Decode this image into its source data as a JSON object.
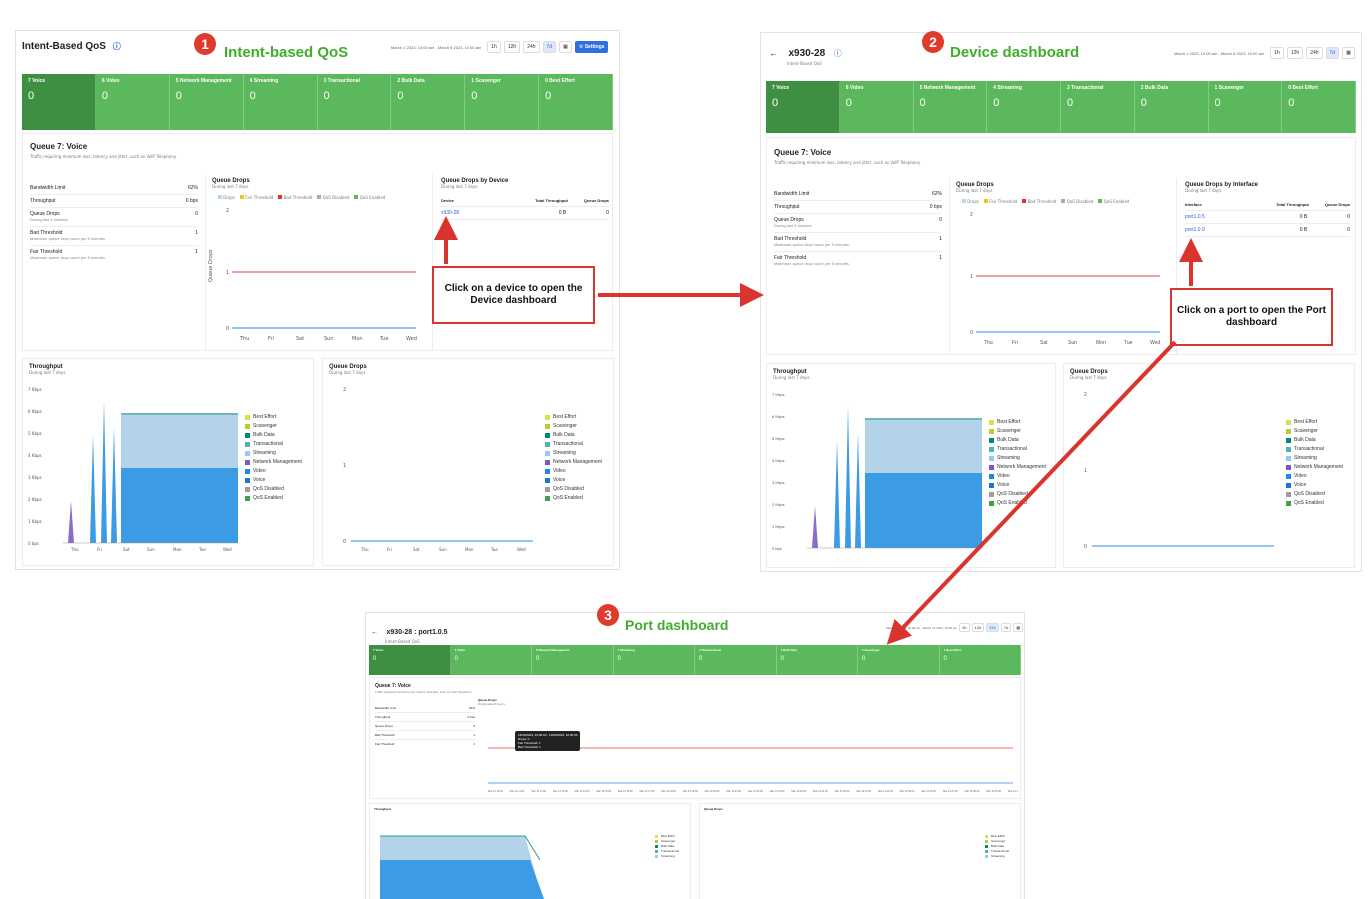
{
  "panel1": {
    "title": "Intent-Based QoS",
    "heading": "Intent-based QoS",
    "badge": "1",
    "date_range": "March 1 2023, 10:00 am - March 8 2023, 10:00 am",
    "time_buttons": [
      "1h",
      "12h",
      "24h",
      "7d"
    ],
    "active_time": "7d",
    "settings_label": "Settings",
    "queues": [
      {
        "label": "7 Voice",
        "value": "0"
      },
      {
        "label": "6 Video",
        "value": "0"
      },
      {
        "label": "5 Network Management",
        "value": "0"
      },
      {
        "label": "4 Streaming",
        "value": "0"
      },
      {
        "label": "3 Transactional",
        "value": "0"
      },
      {
        "label": "2 Bulk Data",
        "value": "0"
      },
      {
        "label": "1 Scavenger",
        "value": "0"
      },
      {
        "label": "0 Best Effort",
        "value": "0"
      }
    ],
    "queue_title": "Queue 7: Voice",
    "queue_desc": "Traffic requiring minimum loss, latency and jitter, such as VoIP Telephony",
    "stats": [
      {
        "label": "Bandwidth Limit",
        "sub": "",
        "value": "62%"
      },
      {
        "label": "Throughput",
        "sub": "",
        "value": "0 bps"
      },
      {
        "label": "Queue Drops",
        "sub": "During last 5 minutes",
        "value": "0"
      },
      {
        "label": "Bad Threshold",
        "sub": "Maximum queue drop count per 5 minutes",
        "value": "1"
      },
      {
        "label": "Fair Threshold",
        "sub": "Maximum queue drop count per 5 minutes",
        "value": "1"
      }
    ],
    "drops_title": "Queue Drops",
    "drops_sub": "During last 7 days",
    "drops_legend": [
      "Drops",
      "Fair Threshold",
      "Bad Threshold",
      "QoS Disabled",
      "QoS Enabled"
    ],
    "drops_yaxis": "Queue Drops",
    "days": [
      "Thu",
      "Fri",
      "Sat",
      "Sun",
      "Mon",
      "Tue",
      "Wed"
    ],
    "by_device_title": "Queue Drops by Device",
    "by_device_sub": "During last 7 days",
    "by_device_cols": [
      "Device",
      "Total Throughput",
      "Queue Drops"
    ],
    "by_device_row": {
      "device": "x930-28",
      "throughput": "0 B",
      "drops": "0"
    },
    "throughput_title": "Throughput",
    "throughput_sub": "During last 7 days",
    "throughput_yaxis": "Throughput",
    "throughput_ticks": [
      "7 Kbps",
      "6 Kbps",
      "5 Kbps",
      "4 Kbps",
      "3 Kbps",
      "2 Kbps",
      "1 Kbps",
      "0 bps"
    ],
    "qdrops2_title": "Queue Drops",
    "qdrops2_sub": "During last 7 days",
    "qdrops2_yaxis": "Queue Drops",
    "legend": [
      "Best Effort",
      "Scavenger",
      "Bulk Data",
      "Transactional",
      "Streaming",
      "Network Management",
      "Video",
      "Voice",
      "QoS Disabled",
      "QoS Enabled"
    ]
  },
  "panel2": {
    "title": "x930-28",
    "subtitle": "Intent-Based QoS",
    "heading": "Device dashboard",
    "badge": "2",
    "date_range": "March 1 2023, 10:00 am - March 8 2023, 10:00 am",
    "time_buttons": [
      "1h",
      "12h",
      "24h",
      "7d"
    ],
    "by_interface_title": "Queue Drops by Interface",
    "by_interface_sub": "During last 7 days",
    "by_interface_cols": [
      "Interface",
      "Total Throughput",
      "Queue Drops"
    ],
    "interfaces": [
      {
        "name": "port1.0.5",
        "throughput": "0 B",
        "drops": "0"
      },
      {
        "name": "port1.0.9",
        "throughput": "0 B",
        "drops": "0"
      }
    ]
  },
  "panel3": {
    "title": "x930-28 : port1.0.5",
    "subtitle": "Intent-Based QoS",
    "heading": "Port dashboard",
    "badge": "3",
    "date_range": "March 13 2023, 10:00 am - March 14 2023, 10:00 am",
    "time_buttons": [
      "1h",
      "12h",
      "24h",
      "7d"
    ],
    "drops_sub": "During last 24 hours",
    "tooltip": {
      "range": "13/03/2023, 10:00:00 - 13/03/2023, 10:30:00",
      "lines": [
        "Drops: 0",
        "Fair Threshold: 1",
        "Bad Threshold: 1"
      ]
    },
    "times": [
      "Mar 13 10:00",
      "Mar 13 11:00",
      "Mar 13 12:00",
      "Mar 13 13:00",
      "Mar 13 14:00",
      "Mar 13 15:00",
      "Mar 13 16:00",
      "Mar 13 17:00",
      "Mar 13 18:00",
      "Mar 13 19:00",
      "Mar 13 20:00",
      "Mar 13 21:00",
      "Mar 13 22:00",
      "Mar 13 23:00",
      "Mar 14 00:00",
      "Mar 14 01:00",
      "Mar 14 02:00",
      "Mar 14 03:00",
      "Mar 14 04:00",
      "Mar 14 05:00",
      "Mar 14 06:00",
      "Mar 14 07:00",
      "Mar 14 08:00",
      "Mar 14 09:00",
      "Mar 14 10:00"
    ]
  },
  "callouts": {
    "device": "Click on a device to open the Device dashboard",
    "port": "Click on a port to open the Port dashboard"
  },
  "colors": {
    "queue_bar": "#5cb85c",
    "accent_red": "#d9352f",
    "heading_green": "#3fae2a",
    "link_blue": "#2b65d9"
  }
}
